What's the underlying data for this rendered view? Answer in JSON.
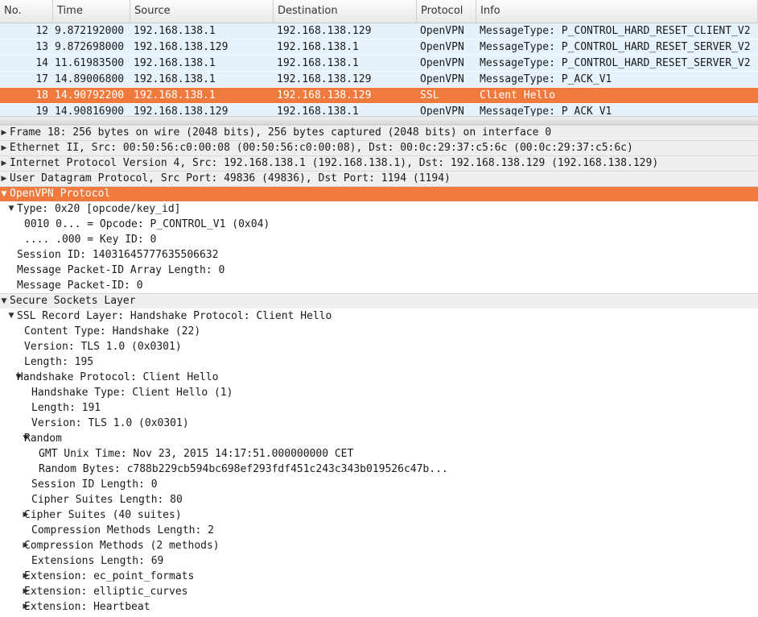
{
  "packet_list": {
    "columns": [
      "No.",
      "Time",
      "Source",
      "Destination",
      "Protocol",
      "Info"
    ],
    "rows": [
      {
        "no": "12",
        "time": "9.872192000",
        "src": "192.168.138.1",
        "dst": "192.168.138.129",
        "proto": "OpenVPN",
        "info": "MessageType: P_CONTROL_HARD_RESET_CLIENT_V2",
        "selected": false
      },
      {
        "no": "13",
        "time": "9.872698000",
        "src": "192.168.138.129",
        "dst": "192.168.138.1",
        "proto": "OpenVPN",
        "info": "MessageType: P_CONTROL_HARD_RESET_SERVER_V2",
        "selected": false
      },
      {
        "no": "14",
        "time": "11.61983500",
        "src": "192.168.138.1",
        "dst": "192.168.138.1",
        "proto": "OpenVPN",
        "info": "MessageType: P_CONTROL_HARD_RESET_SERVER_V2",
        "selected": false
      },
      {
        "no": "17",
        "time": "14.89006800",
        "src": "192.168.138.1",
        "dst": "192.168.138.129",
        "proto": "OpenVPN",
        "info": "MessageType: P_ACK_V1",
        "selected": false
      },
      {
        "no": "18",
        "time": "14.90792200",
        "src": "192.168.138.1",
        "dst": "192.168.138.129",
        "proto": "SSL",
        "info": "Client Hello",
        "selected": true
      },
      {
        "no": "19",
        "time": "14.90816900",
        "src": "192.168.138.129",
        "dst": "192.168.138.1",
        "proto": "OpenVPN",
        "info": "MessageType: P_ACK_V1",
        "selected": false
      }
    ]
  },
  "details": [
    {
      "text": "Frame 18: 256 bytes on wire (2048 bits), 256 bytes captured (2048 bits) on interface 0",
      "level": 0,
      "arrow": "collapsed",
      "top": true,
      "selected": false
    },
    {
      "text": "Ethernet II, Src: 00:50:56:c0:00:08 (00:50:56:c0:00:08), Dst: 00:0c:29:37:c5:6c (00:0c:29:37:c5:6c)",
      "level": 0,
      "arrow": "collapsed",
      "top": true,
      "selected": false
    },
    {
      "text": "Internet Protocol Version 4, Src: 192.168.138.1 (192.168.138.1), Dst: 192.168.138.129 (192.168.138.129)",
      "level": 0,
      "arrow": "collapsed",
      "top": true,
      "selected": false
    },
    {
      "text": "User Datagram Protocol, Src Port: 49836 (49836), Dst Port: 1194 (1194)",
      "level": 0,
      "arrow": "collapsed",
      "top": true,
      "selected": false
    },
    {
      "text": "OpenVPN Protocol",
      "level": 0,
      "arrow": "expanded",
      "top": true,
      "selected": true
    },
    {
      "text": "Type: 0x20 [opcode/key_id]",
      "level": 1,
      "arrow": "expanded",
      "top": false,
      "selected": false
    },
    {
      "text": "0010 0... = Opcode: P_CONTROL_V1 (0x04)",
      "level": 3,
      "arrow": "none",
      "top": false,
      "selected": false
    },
    {
      "text": ".... .000 = Key ID: 0",
      "level": 3,
      "arrow": "none",
      "top": false,
      "selected": false
    },
    {
      "text": "Session ID: 14031645777635506632",
      "level": 2,
      "arrow": "none",
      "top": false,
      "selected": false
    },
    {
      "text": "Message Packet-ID Array Length: 0",
      "level": 2,
      "arrow": "none",
      "top": false,
      "selected": false
    },
    {
      "text": "Message Packet-ID: 0",
      "level": 2,
      "arrow": "none",
      "top": false,
      "selected": false
    },
    {
      "text": "Secure Sockets Layer",
      "level": 0,
      "arrow": "expanded",
      "top": true,
      "selected": false
    },
    {
      "text": "SSL Record Layer: Handshake Protocol: Client Hello",
      "level": 1,
      "arrow": "expanded",
      "top": false,
      "selected": false
    },
    {
      "text": "Content Type: Handshake (22)",
      "level": 3,
      "arrow": "none",
      "top": false,
      "selected": false
    },
    {
      "text": "Version: TLS 1.0 (0x0301)",
      "level": 3,
      "arrow": "none",
      "top": false,
      "selected": false
    },
    {
      "text": "Length: 195",
      "level": 3,
      "arrow": "none",
      "top": false,
      "selected": false
    },
    {
      "text": "Handshake Protocol: Client Hello",
      "level": 2,
      "arrow": "expanded",
      "top": false,
      "selected": false
    },
    {
      "text": "Handshake Type: Client Hello (1)",
      "level": 4,
      "arrow": "none",
      "top": false,
      "selected": false
    },
    {
      "text": "Length: 191",
      "level": 4,
      "arrow": "none",
      "top": false,
      "selected": false
    },
    {
      "text": "Version: TLS 1.0 (0x0301)",
      "level": 4,
      "arrow": "none",
      "top": false,
      "selected": false
    },
    {
      "text": "Random",
      "level": 3,
      "arrow": "expanded",
      "top": false,
      "selected": false
    },
    {
      "text": "GMT Unix Time: Nov 23, 2015 14:17:51.000000000 CET",
      "level": 5,
      "arrow": "none",
      "top": false,
      "selected": false
    },
    {
      "text": "Random Bytes: c788b229cb594bc698ef293fdf451c243c343b019526c47b...",
      "level": 5,
      "arrow": "none",
      "top": false,
      "selected": false
    },
    {
      "text": "Session ID Length: 0",
      "level": 4,
      "arrow": "none",
      "top": false,
      "selected": false
    },
    {
      "text": "Cipher Suites Length: 80",
      "level": 4,
      "arrow": "none",
      "top": false,
      "selected": false
    },
    {
      "text": "Cipher Suites (40 suites)",
      "level": 3,
      "arrow": "collapsed",
      "top": false,
      "selected": false
    },
    {
      "text": "Compression Methods Length: 2",
      "level": 4,
      "arrow": "none",
      "top": false,
      "selected": false
    },
    {
      "text": "Compression Methods (2 methods)",
      "level": 3,
      "arrow": "collapsed",
      "top": false,
      "selected": false
    },
    {
      "text": "Extensions Length: 69",
      "level": 4,
      "arrow": "none",
      "top": false,
      "selected": false
    },
    {
      "text": "Extension: ec_point_formats",
      "level": 3,
      "arrow": "collapsed",
      "top": false,
      "selected": false
    },
    {
      "text": "Extension: elliptic_curves",
      "level": 3,
      "arrow": "collapsed",
      "top": false,
      "selected": false
    },
    {
      "text": "Extension: Heartbeat",
      "level": 3,
      "arrow": "collapsed",
      "top": false,
      "selected": false
    }
  ]
}
